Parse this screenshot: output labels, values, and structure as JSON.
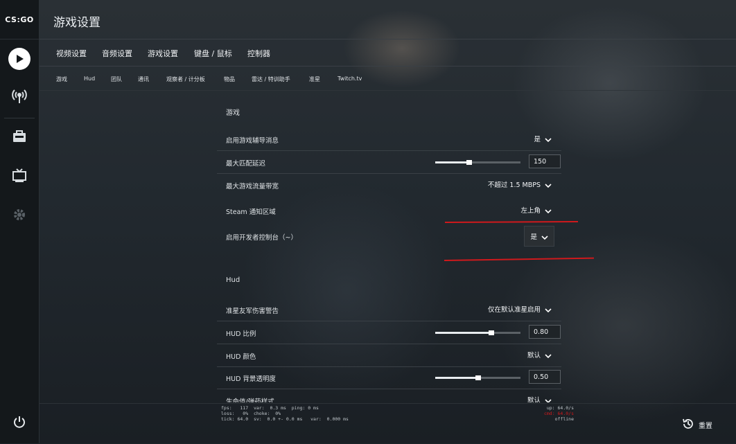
{
  "app": {
    "logo_text": "CS:GO",
    "page_title": "游戏设置"
  },
  "sidebar": {
    "items": [
      {
        "icon": "play-icon"
      },
      {
        "icon": "broadcast-icon"
      },
      {
        "icon": "inventory-icon"
      },
      {
        "icon": "tv-icon"
      },
      {
        "icon": "gear-icon"
      },
      {
        "icon": "power-icon"
      }
    ]
  },
  "main_tabs": [
    "视频设置",
    "音频设置",
    "游戏设置",
    "键盘 / 鼠标",
    "控制器"
  ],
  "sub_tabs": [
    "游戏",
    "Hud",
    "团队",
    "通讯",
    "观察者 / 计分板",
    "物品",
    "雷达 / 特训助手",
    "准星",
    "Twitch.tv"
  ],
  "sections": {
    "game": {
      "title": "游戏",
      "rows": [
        {
          "label": "启用游戏辅导消息",
          "value": "是"
        },
        {
          "label": "最大匹配延迟",
          "value": "150",
          "slider": 0.4
        },
        {
          "label": "最大游戏流量带宽",
          "value": "不超过 1.5 MBPS"
        },
        {
          "label": "Steam 通知区域",
          "value": "左上角"
        },
        {
          "label": "启用开发者控制台（~）",
          "value": "是"
        }
      ]
    },
    "hud": {
      "title": "Hud",
      "rows": [
        {
          "label": "准星友军伤害警告",
          "value": "仅在默认准星启用"
        },
        {
          "label": "HUD 比例",
          "value": "0.80",
          "slider": 0.66
        },
        {
          "label": "HUD 颜色",
          "value": "默认"
        },
        {
          "label": "HUD 背景透明度",
          "value": "0.50",
          "slider": 0.5
        },
        {
          "label": "生命值/弹药样式",
          "value": "默认"
        }
      ]
    }
  },
  "netgraph": {
    "line1": "fps:   117  var:  0.3 ms  ping: 0 ms",
    "line2": "loss:   0%  choke:  0%",
    "line3": "tick: 64.0  sv:  0.0 +- 0.0 ms   var:  0.000 ms",
    "right1": "up: 64.0/s",
    "right2": "cmd: 64.0/s",
    "right3": "offline"
  },
  "footer": {
    "reset_label": "重置"
  },
  "colors": {
    "accent_red": "#d0191c",
    "background": "#1c2329"
  }
}
